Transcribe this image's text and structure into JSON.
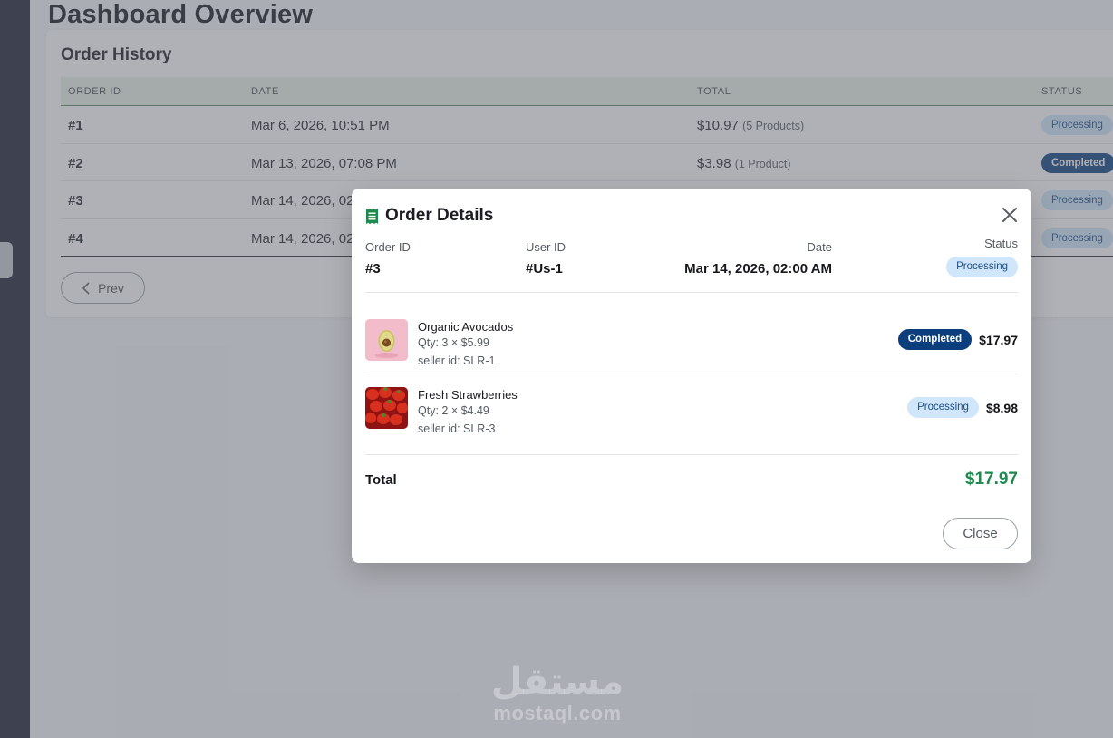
{
  "page": {
    "title": "Dashboard Overview"
  },
  "order_history": {
    "title": "Order History",
    "columns": [
      "ORDER ID",
      "DATE",
      "TOTAL",
      "STATUS"
    ],
    "rows": [
      {
        "id": "#1",
        "date": "Mar 6, 2026, 10:51 PM",
        "total": "$10.97",
        "products": "(5 Products)",
        "status": "Processing"
      },
      {
        "id": "#2",
        "date": "Mar 13, 2026, 07:08 PM",
        "total": "$3.98",
        "products": "(1 Product)",
        "status": "Completed"
      },
      {
        "id": "#3",
        "date": "Mar 14, 2026, 02:",
        "total": "",
        "products": "",
        "status": "Processing"
      },
      {
        "id": "#4",
        "date": "Mar 14, 2026, 02:",
        "total": "",
        "products": "",
        "status": "Processing"
      }
    ],
    "prev_label": "Prev"
  },
  "modal": {
    "title": "Order Details",
    "order_id_label": "Order ID",
    "order_id": "#3",
    "user_id_label": "User ID",
    "user_id": "#Us-1",
    "date_label": "Date",
    "date": "Mar 14, 2026, 02:00 AM",
    "status_label": "Status",
    "status": "Processing",
    "items": [
      {
        "name": "Organic Avocados",
        "qty": "Qty: 3 × $5.99",
        "seller": "seller id: SLR-1",
        "status": "Completed",
        "price": "$17.97"
      },
      {
        "name": "Fresh Strawberries",
        "qty": "Qty: 2 × $4.49",
        "seller": "seller id: SLR-3",
        "status": "Processing",
        "price": "$8.98"
      }
    ],
    "total_label": "Total",
    "total_value": "$17.97",
    "close_label": "Close"
  },
  "watermark": {
    "arabic": "مستقل",
    "latin": "mostaql.com"
  },
  "colors": {
    "processing_bg": "#cfe6fb",
    "completed_bg": "#0c3e7e",
    "total_green": "#1e8a4e",
    "header_green": "#e8f3e7"
  },
  "icons": {
    "title_icon": "receipt-icon",
    "close_icon": "close-icon",
    "prev_icon": "chevron-left-icon"
  }
}
